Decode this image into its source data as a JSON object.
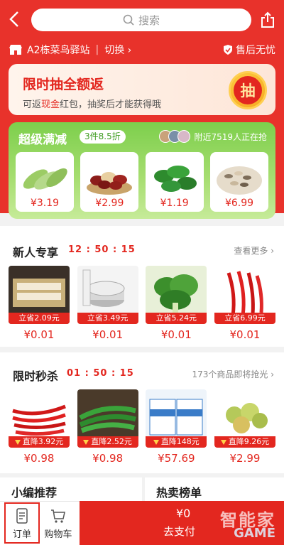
{
  "header": {
    "search_placeholder": "搜索",
    "station_name": "A2栋菜鸟驿站",
    "switch_label": "切换",
    "after_sale_label": "售后无忧"
  },
  "lottery": {
    "title": "限时抽全额返",
    "subtitle_pre": "可返",
    "subtitle_highlight": "现金",
    "subtitle_post": "红包，抽奖后才能获得哦",
    "button_label": "抽"
  },
  "super_deal": {
    "title": "超级满减",
    "tag": "3件8.5折",
    "nearby_text": "附近7519人正在抢",
    "items": [
      {
        "name": "zucchini",
        "price": "¥3.19"
      },
      {
        "name": "dates",
        "price": "¥2.99"
      },
      {
        "name": "green-peppers",
        "price": "¥1.19"
      },
      {
        "name": "sunflower-seeds",
        "price": "¥6.99"
      }
    ]
  },
  "new_user": {
    "title": "新人专享",
    "timer": "12 : 50 : 15",
    "more": "查看更多",
    "items": [
      {
        "badge": "立省2.09元",
        "price": "¥0.01"
      },
      {
        "badge": "立省3.49元",
        "price": "¥0.01"
      },
      {
        "badge": "立省5.24元",
        "price": "¥0.01"
      },
      {
        "badge": "立省6.99元",
        "price": "¥0.01"
      }
    ]
  },
  "flash_sale": {
    "title": "限时秒杀",
    "timer": "01 : 50 : 15",
    "more": "173个商品即将抢光",
    "items": [
      {
        "badge": "直降3.92元",
        "price": "¥0.98"
      },
      {
        "badge": "直降2.52元",
        "price": "¥0.98"
      },
      {
        "badge": "直降148元",
        "price": "¥57.69"
      },
      {
        "badge": "直降9.26元",
        "price": "¥2.99"
      }
    ]
  },
  "bottom_sections": {
    "left": "小编推荐",
    "right": "热卖榜单"
  },
  "tabbar": {
    "orders": "订单",
    "cart": "购物车",
    "pay_amount": "¥0",
    "pay_label": "去支付"
  },
  "watermark": {
    "line1": "智能家",
    "line2": "GAME"
  },
  "colors": {
    "brand_red": "#e3271f",
    "super_green": "#7dcf4c"
  }
}
